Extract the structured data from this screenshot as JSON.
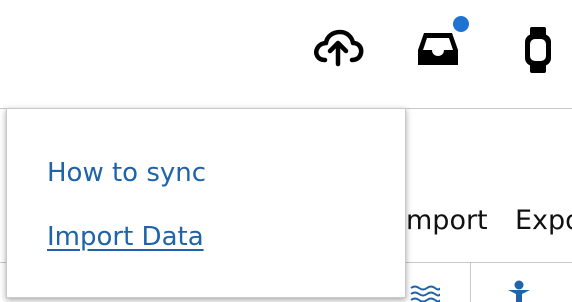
{
  "header": {
    "icons": {
      "upload": "cloud-upload-icon",
      "inbox": "inbox-icon",
      "device": "watch-icon"
    },
    "notification_color": "#1e73d2"
  },
  "dropdown": {
    "items": [
      {
        "label": "How to sync"
      },
      {
        "label": "Import Data"
      }
    ],
    "link_color": "#1f63a9"
  },
  "toolbar": {
    "import_label": "mport",
    "export_label": "Expo",
    "icons": [
      "waves-icon",
      "person-icon"
    ]
  }
}
